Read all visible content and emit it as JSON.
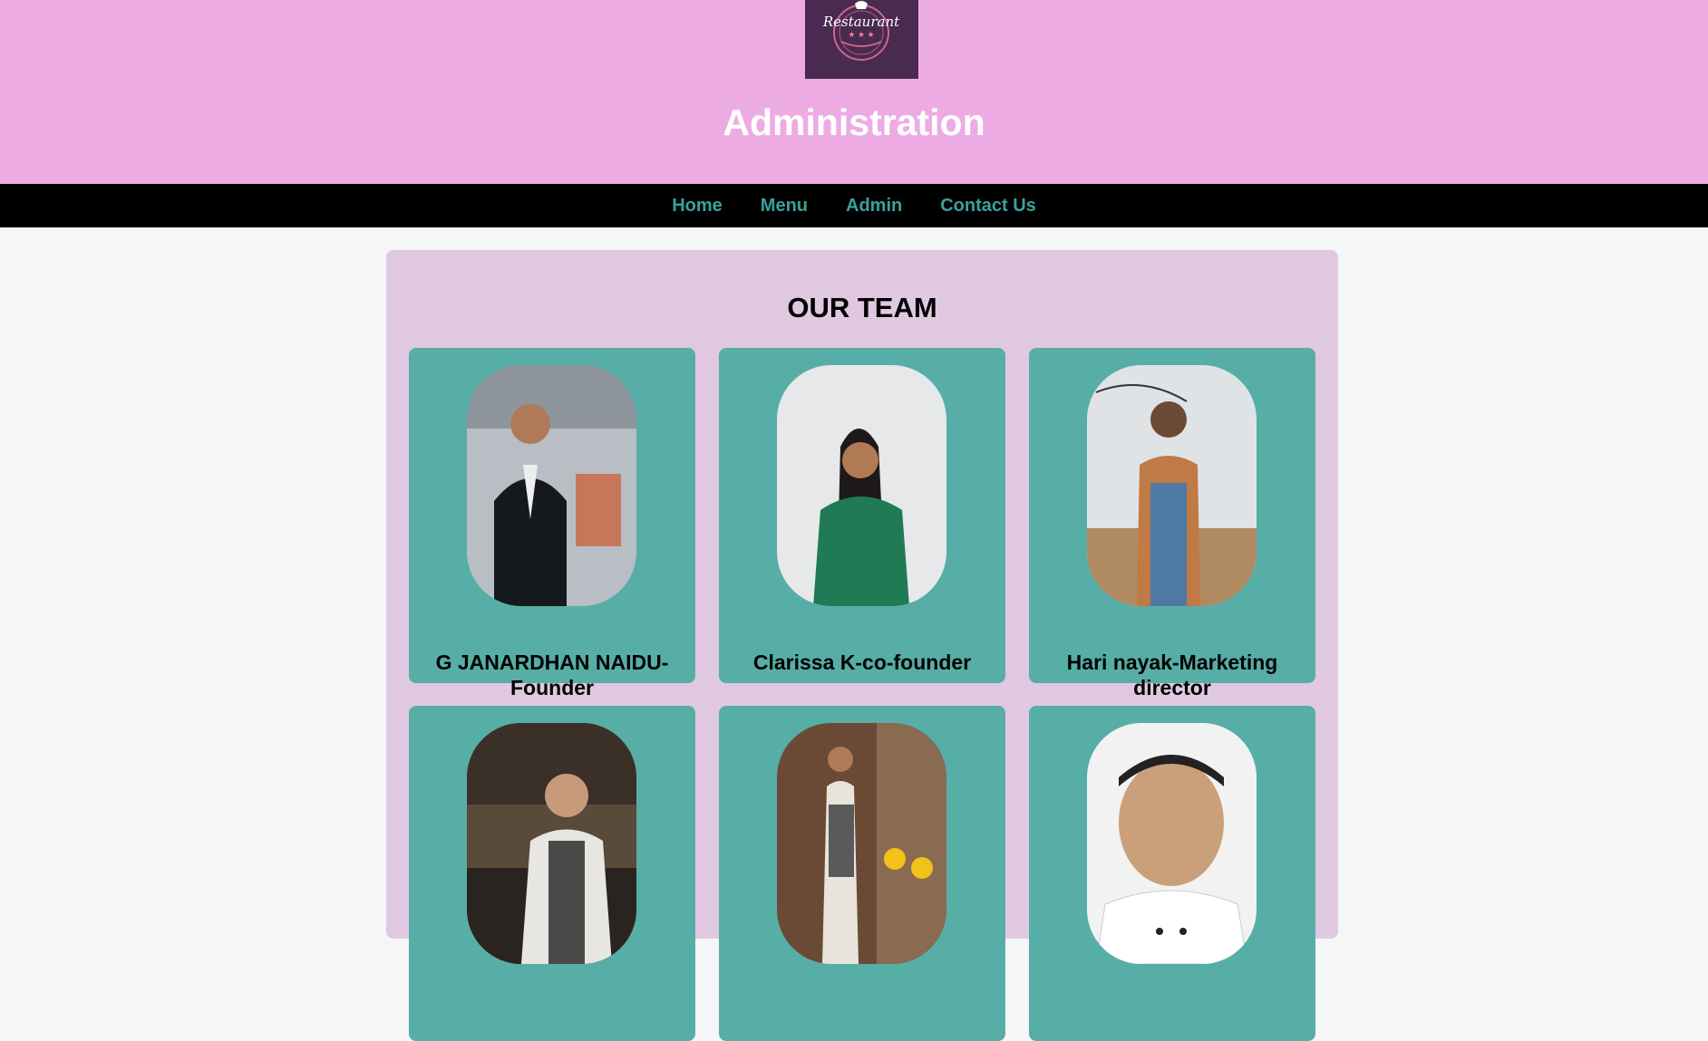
{
  "header": {
    "logo_text": "Restaurant",
    "title": "Administration"
  },
  "nav": {
    "items": [
      "Home",
      "Menu",
      "Admin",
      "Contact Us"
    ]
  },
  "team": {
    "title": "OUR TEAM",
    "members": [
      {
        "name": "G JANARDHAN NAIDU-Founder"
      },
      {
        "name": "Clarissa K-co-founder"
      },
      {
        "name": "Hari nayak-Marketing director"
      },
      {
        "name": ""
      },
      {
        "name": ""
      },
      {
        "name": ""
      }
    ]
  },
  "colors": {
    "header_bg": "#ecace3",
    "nav_bg": "#000000",
    "nav_link": "#3aa19e",
    "panel_bg": "#e0c8e0",
    "card_bg": "#57aea6",
    "page_bg": "#f5f6f8"
  }
}
